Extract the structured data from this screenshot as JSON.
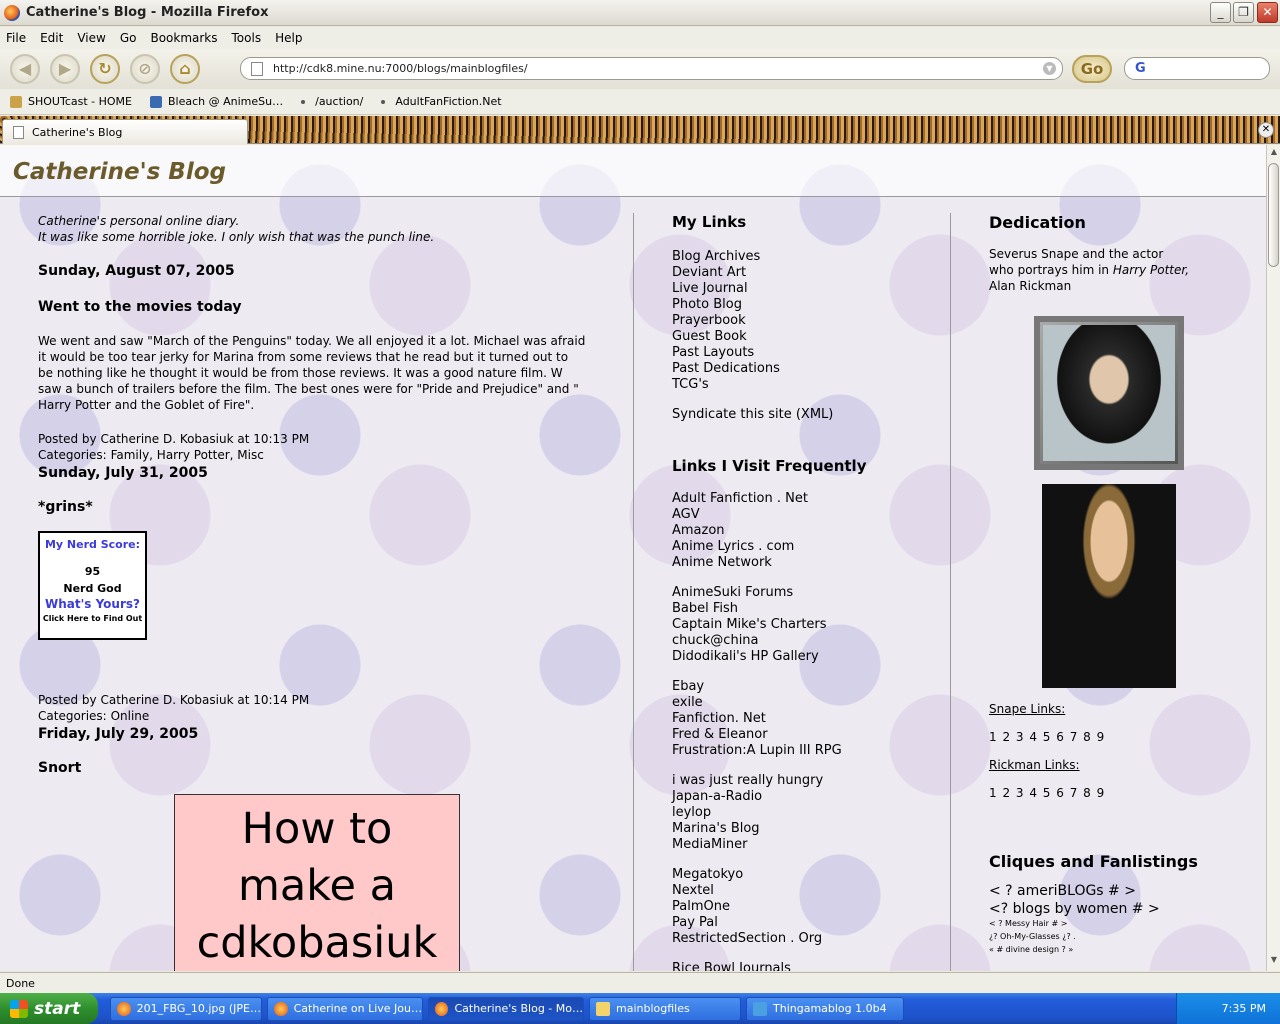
{
  "window": {
    "title": "Catherine's Blog - Mozilla Firefox"
  },
  "menu": [
    "File",
    "Edit",
    "View",
    "Go",
    "Bookmarks",
    "Tools",
    "Help"
  ],
  "nav": {
    "url": "http://cdk8.mine.nu:7000/blogs/mainblogfiles/",
    "go_label": "Go",
    "search_label": "G"
  },
  "bookmarks": [
    "SHOUTcast - HOME",
    "Bleach @ AnimeSu…",
    "/auction/",
    "AdultFanFiction.Net"
  ],
  "tab": {
    "label": "Catherine's Blog"
  },
  "blog": {
    "title": "Catherine's Blog",
    "tagline1": "Catherine's personal online diary.",
    "tagline2": "It was like some horrible joke. I only wish that was the punch line.",
    "posts": [
      {
        "date": "Sunday, August 07, 2005",
        "title": "Went to the movies today",
        "text": "We went and saw \"March of the Penguins\" today. We all enjoyed it a lot. Michael was afraid it would be too tear jerky for Marina from some reviews that he read but it turned out to be nothing like he thought it would be from those reviews. It was a good nature film. W saw a bunch of trailers before the film. The best ones were for \"Pride and Prejudice\" and \" Harry Potter and the Goblet of Fire\".",
        "posted": "Posted by Catherine D. Kobasiuk at 10:13 PM",
        "categories_label": "Categories:",
        "categories": "Family, Harry Potter, Misc"
      },
      {
        "date": "Sunday, July 31, 2005",
        "title": "*grins*",
        "posted": "Posted by Catherine D. Kobasiuk at 10:14 PM",
        "categories_label": "Categories:",
        "categories": "Online"
      },
      {
        "date": "Friday, July 29, 2005",
        "title": "Snort"
      }
    ],
    "nerd_badge": {
      "line1": "My Nerd Score:",
      "score": "95",
      "rank": "Nerd God",
      "line4": "What's Yours?",
      "line5": "Click Here to Find Out"
    },
    "howto": {
      "line1": "How to",
      "line2": "make a",
      "line3": "cdkobasiuk"
    }
  },
  "sidebar": {
    "my_links_title": "My Links",
    "my_links": [
      "Blog Archives",
      "Deviant Art",
      "Live Journal",
      "Photo Blog",
      "Prayerbook",
      "Guest Book",
      "Past Layouts",
      "Past Dedications",
      "TCG's"
    ],
    "syndicate": "Syndicate this site (XML)",
    "freq_title": "Links I Visit Frequently",
    "freq_groups": [
      [
        "Adult Fanfiction . Net",
        "AGV",
        "Amazon",
        "Anime Lyrics . com",
        "Anime Network"
      ],
      [
        "AnimeSuki Forums",
        "Babel Fish",
        "Captain Mike's Charters",
        "chuck@china",
        "Didodikali's HP Gallery"
      ],
      [
        "Ebay",
        "exile",
        "Fanfiction. Net",
        "Fred & Eleanor",
        "Frustration:A Lupin III RPG"
      ],
      [
        "i was just really hungry",
        "Japan-a-Radio",
        "leylop",
        "Marina's Blog",
        "MediaMiner"
      ],
      [
        "Megatokyo",
        "Nextel",
        "PalmOne",
        "Pay Pal",
        "RestrictedSection . Org"
      ],
      [
        "Rice Bowl Journals"
      ]
    ]
  },
  "dedication": {
    "title": "Dedication",
    "text_pre": "Severus Snape and the actor who portrays him in ",
    "text_em": "Harry Potter,",
    "text_post": " Alan Rickman",
    "snape_label": "Snape Links:",
    "rickman_label": "Rickman Links:",
    "numbers": "1 2 3 4 5 6 7 8 9",
    "cliques_title": "Cliques and Fanlistings",
    "clique1": "< ? ameriBLOGs # >",
    "clique2": "<? blogs by women # >",
    "small": [
      "< ? Messy Hair # >",
      "¿? Oh-My-Glasses ¿? .",
      "« # divine design ? »"
    ]
  },
  "status": {
    "text": "Done"
  },
  "taskbar": {
    "start": "start",
    "tasks": [
      "201_FBG_10.jpg (JPE…",
      "Catherine on Live Jou…",
      "Catherine's Blog - Mo…",
      "mainblogfiles",
      "Thingamablog 1.0b4"
    ],
    "clock": "7:35 PM"
  },
  "colors": {
    "blog_title": "#6b5a2a",
    "howto_bg": "#ffc9c9",
    "taskbar": "#245edb"
  }
}
